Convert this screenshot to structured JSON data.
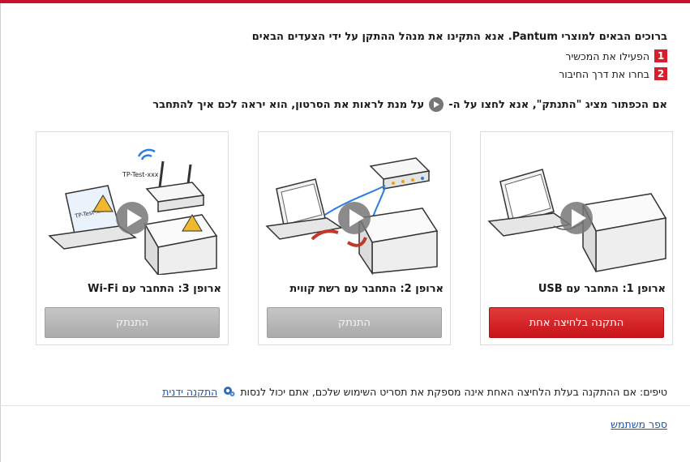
{
  "header": {
    "welcome": "ברוכים הבאים למוצרי Pantum. אנא התקינו את מנהל ההתקן על ידי הצעדים הבאים",
    "steps": [
      {
        "number": "1",
        "label": "הפעילו את המכשיר"
      },
      {
        "number": "2",
        "label": "בחרו את דרך החיבור"
      }
    ],
    "hint_before": "אם הכפתור מציג \"התנתק\", אנא לחצו על ה-",
    "hint_after": "על מנת לראות את הסרטון, הוא יראה לכם איך להתחבר"
  },
  "options": [
    {
      "title": "ארופן 1: התחבר עם USB",
      "button": "התקנה בלחיצה אחת",
      "state": "active"
    },
    {
      "title": "ארופן 2: התחבר עם רשת קווית",
      "button": "התנתק",
      "state": "disabled"
    },
    {
      "title": "ארופן 3: התחבר עם Wi-Fi",
      "button": "התנתק",
      "state": "disabled"
    }
  ],
  "art_labels": {
    "wifi_ssid": "TP-Test-xxx"
  },
  "tips": {
    "text": "טיפים: אם ההתקנה בעלת הלחיצה האחת אינה מספקת את תסריט השימוש שלכם, אתם יכול לנסות",
    "link": "התקנה ידנית",
    "icon": "gear-icon"
  },
  "footer": {
    "manual_link": "ספר משתמש"
  },
  "colors": {
    "accent": "#c8102e",
    "primary_button": "#d81e2a",
    "disabled_button": "#b5b5b5",
    "link": "#2255aa"
  }
}
